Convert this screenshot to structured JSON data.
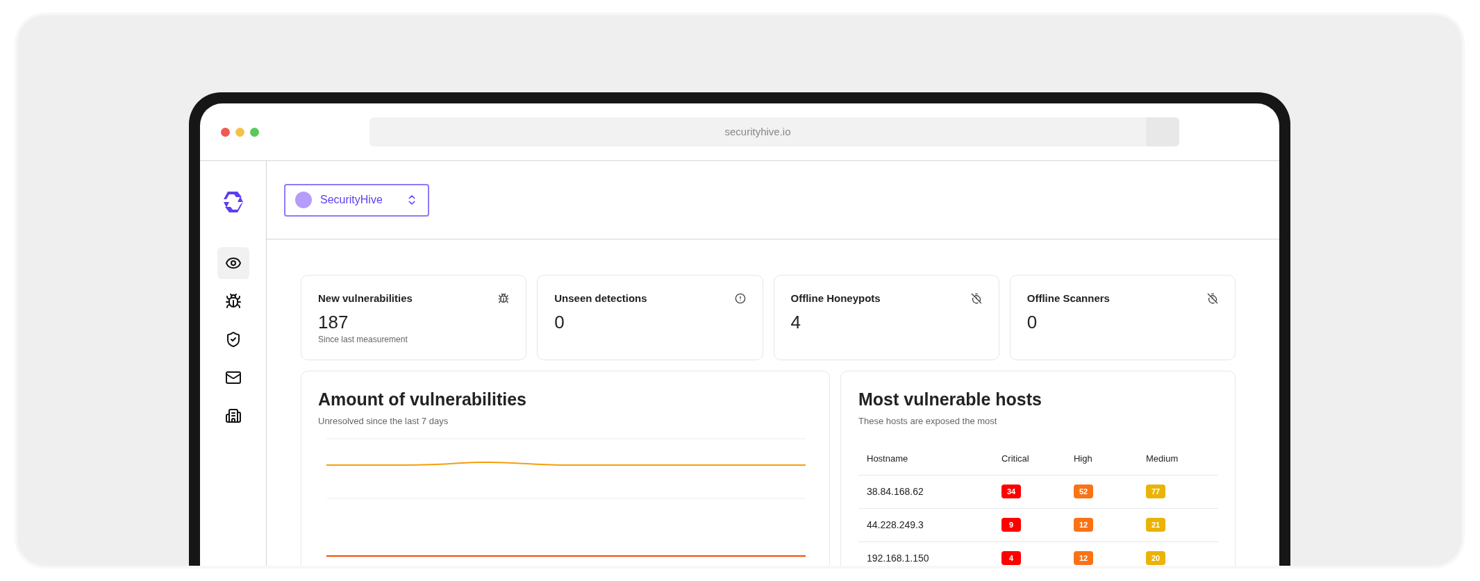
{
  "browser": {
    "url": "securityhive.io"
  },
  "sidebar": {
    "items": [
      {
        "selected": true
      },
      {
        "selected": false
      },
      {
        "selected": false
      },
      {
        "selected": false
      },
      {
        "selected": false
      }
    ]
  },
  "org_selector": {
    "name": "SecurityHive"
  },
  "stat_cards": [
    {
      "title": "New vulnerabilities",
      "value": "187",
      "caption": "Since last measurement"
    },
    {
      "title": "Unseen detections",
      "value": "0"
    },
    {
      "title": "Offline Honeypots",
      "value": "4"
    },
    {
      "title": "Offline Scanners",
      "value": "0"
    }
  ],
  "vulnerability_chart": {
    "title": "Amount of vulnerabilities",
    "subtitle": "Unresolved since the last 7 days"
  },
  "hosts_table": {
    "title": "Most vulnerable hosts",
    "subtitle": "These hosts are exposed the most",
    "columns": [
      {
        "label": "Hostname"
      },
      {
        "label": "Critical",
        "color": "#ff0000"
      },
      {
        "label": "High",
        "color": "#f97316"
      },
      {
        "label": "Medium",
        "color": "#eab308"
      }
    ],
    "rows": [
      {
        "cells": [
          "38.84.168.62",
          "34",
          "52",
          "77"
        ]
      },
      {
        "cells": [
          "44.228.249.3",
          "9",
          "12",
          "21"
        ]
      },
      {
        "cells": [
          "192.168.1.150",
          "4",
          "12",
          "20"
        ]
      }
    ]
  }
}
